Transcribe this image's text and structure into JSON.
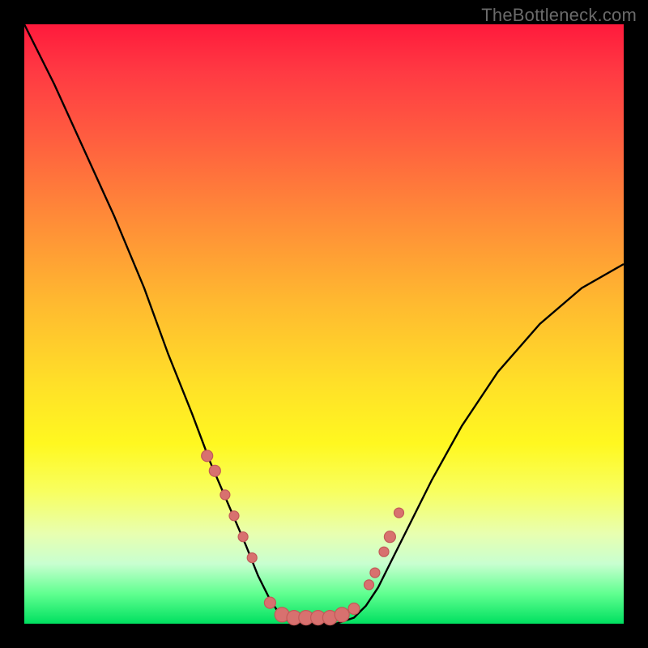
{
  "watermark": "TheBottleneck.com",
  "colors": {
    "frame": "#000000",
    "curve": "#000000",
    "dot_fill": "#d8716f",
    "dot_stroke": "#c25a58",
    "gradient_top": "#ff1a3c",
    "gradient_bottom": "#00e060"
  },
  "chart_data": {
    "type": "line",
    "title": "",
    "xlabel": "",
    "ylabel": "",
    "xlim": [
      0,
      100
    ],
    "ylim": [
      0,
      100
    ],
    "grid": false,
    "legend": false,
    "note": "V-shaped bottleneck curve. y=0 (bottom/green) is optimal; y=100 (top/red) is severe bottleneck. No numeric axis ticks are rendered in the image; values are estimated from pixel positions.",
    "series": [
      {
        "name": "bottleneck-curve",
        "x": [
          0,
          5,
          10,
          15,
          20,
          24,
          28,
          31,
          34,
          37,
          39,
          41,
          43,
          45,
          48,
          52,
          55,
          57,
          59,
          61,
          64,
          68,
          73,
          79,
          86,
          93,
          100
        ],
        "y": [
          100,
          90,
          79,
          68,
          56,
          45,
          35,
          27,
          20,
          13,
          8,
          4,
          1,
          0,
          0,
          0,
          1,
          3,
          6,
          10,
          16,
          24,
          33,
          42,
          50,
          56,
          60
        ]
      }
    ],
    "markers": {
      "name": "highlighted-points",
      "note": "Salmon circular markers clustered near the trough and lower arms of the V.",
      "x": [
        30.5,
        31.8,
        33.5,
        35.0,
        36.5,
        38.0,
        41.0,
        43.0,
        45.0,
        47.0,
        49.0,
        51.0,
        53.0,
        55.0,
        57.5,
        58.5,
        60.0,
        61.0,
        62.5
      ],
      "y": [
        28.0,
        25.5,
        21.5,
        18.0,
        14.5,
        11.0,
        3.5,
        1.5,
        1.0,
        1.0,
        1.0,
        1.0,
        1.5,
        2.5,
        6.5,
        8.5,
        12.0,
        14.5,
        18.5
      ],
      "r": [
        7,
        7,
        6,
        6,
        6,
        6,
        7,
        9,
        9,
        9,
        9,
        9,
        9,
        7,
        6,
        6,
        6,
        7,
        6
      ]
    }
  }
}
